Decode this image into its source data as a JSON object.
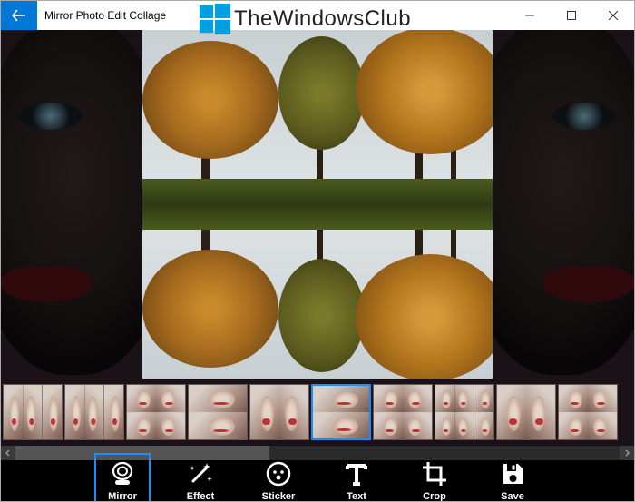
{
  "window": {
    "title": "Mirror Photo Edit Collage"
  },
  "brand": {
    "name": "TheWindowsClub",
    "logo_color_1": "#00a0e3",
    "logo_color_2": "#0078d7"
  },
  "thumbnails": {
    "count": 10,
    "selected_index": 5
  },
  "toolbar": {
    "items": [
      {
        "id": "mirror",
        "label": "Mirror",
        "icon": "mirror-icon",
        "active": true
      },
      {
        "id": "effect",
        "label": "Effect",
        "icon": "wand-icon",
        "active": false
      },
      {
        "id": "sticker",
        "label": "Sticker",
        "icon": "sticker-icon",
        "active": false
      },
      {
        "id": "text",
        "label": "Text",
        "icon": "text-icon",
        "active": false
      },
      {
        "id": "crop",
        "label": "Crop",
        "icon": "crop-icon",
        "active": false
      },
      {
        "id": "save",
        "label": "Save",
        "icon": "save-icon",
        "active": false
      }
    ]
  },
  "colors": {
    "accent": "#1a8cff",
    "titlebar_accent": "#0078d7"
  }
}
